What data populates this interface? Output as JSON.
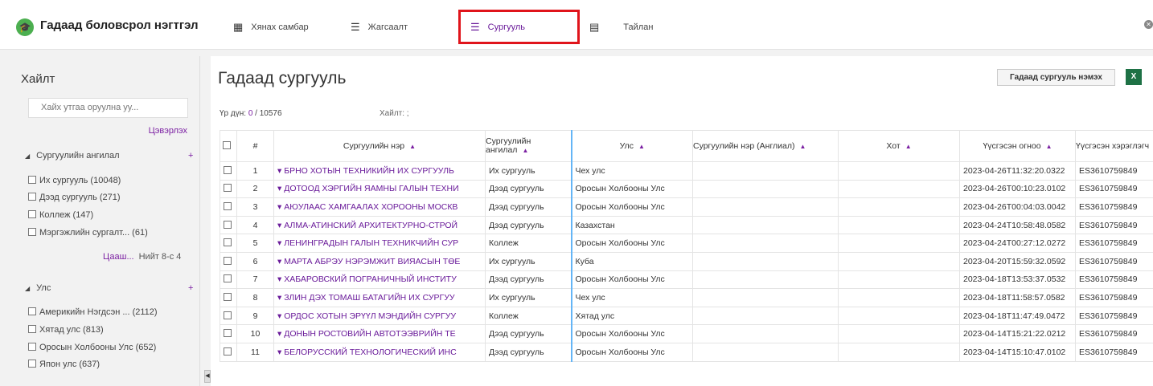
{
  "app": {
    "title": "Гадаад боловсрол нэгтгэл",
    "logo_icon": "graduation-cap-icon"
  },
  "nav": [
    {
      "label": "Хянах самбар",
      "icon": "dashboard-icon"
    },
    {
      "label": "Жагсаалт",
      "icon": "list-icon"
    },
    {
      "label": "Сургууль",
      "icon": "list-bullets-icon",
      "active": true
    },
    {
      "label": "Тайлан",
      "icon": "report-icon"
    }
  ],
  "sidebar": {
    "title": "Хайлт",
    "search_placeholder": "Хайх утгаа оруулна уу...",
    "clear_label": "Цэвэрлэх",
    "facets": [
      {
        "title": "Сургуулийн ангилал",
        "options": [
          "Их сургууль (10048)",
          "Дээд сургууль (271)",
          "Коллеж (147)",
          "Мэргэжлийн сургалт... (61)"
        ],
        "more_label": "Цааш...",
        "total_label": "Нийт 8-с 4"
      },
      {
        "title": "Улс",
        "options": [
          "Америкийн Нэгдсэн ... (2112)",
          "Хятад улс (813)",
          "Оросын Холбооны Улс (652)",
          "Япон улс (637)"
        ]
      }
    ]
  },
  "main": {
    "title": "Гадаад сургууль",
    "add_button": "Гадаад сургууль нэмэх",
    "excel_icon": "excel-icon",
    "result_label": "Үр дүн:",
    "result_shown": "0",
    "result_total": "/ 10576",
    "search_label": "Хайлт: ;",
    "columns": [
      "#",
      "Сургуулийн нэр",
      "Сургуулийн ангилал",
      "Улс",
      "Сургуулийн нэр (Англиал)",
      "Хот",
      "Үүсгэсэн огноо",
      "Үүсгэсэн хэрэглэгч"
    ],
    "rows": [
      {
        "n": "1",
        "name": "БРНО ХОТЫН ТЕХНИКИЙН ИХ СУРГУУЛЬ",
        "type": "Их сургууль",
        "country": "Чех улс",
        "en": "",
        "city": "",
        "created": "2023-04-26T11:32:20.0322",
        "user": "ES3610759849"
      },
      {
        "n": "2",
        "name": "ДОТООД ХЭРГИЙН ЯАМНЫ ГАЛЫН ТЕХНИ",
        "type": "Дээд сургууль",
        "country": "Оросын Холбооны Улс",
        "en": "",
        "city": "",
        "created": "2023-04-26T00:10:23.0102",
        "user": "ES3610759849"
      },
      {
        "n": "3",
        "name": "АЮУЛААС ХАМГААЛАХ ХОРООНЫ МОСКВ",
        "type": "Дээд сургууль",
        "country": "Оросын Холбооны Улс",
        "en": "",
        "city": "",
        "created": "2023-04-26T00:04:03.0042",
        "user": "ES3610759849"
      },
      {
        "n": "4",
        "name": "АЛМА-АТИНСКИЙ АРХИТЕКТУРНО-СТРОЙ",
        "type": "Дээд сургууль",
        "country": "Казахстан",
        "en": "",
        "city": "",
        "created": "2023-04-24T10:58:48.0582",
        "user": "ES3610759849"
      },
      {
        "n": "5",
        "name": "ЛЕНИНГРАДЫН ГАЛЫН ТЕХНИКЧИЙН СУР",
        "type": "Коллеж",
        "country": "Оросын Холбооны Улс",
        "en": "",
        "city": "",
        "created": "2023-04-24T00:27:12.0272",
        "user": "ES3610759849"
      },
      {
        "n": "6",
        "name": "МАРТА АБРЭУ НЭРЭМЖИТ ВИЯАСЫН ТӨЕ",
        "type": "Их сургууль",
        "country": "Куба",
        "en": "",
        "city": "",
        "created": "2023-04-20T15:59:32.0592",
        "user": "ES3610759849"
      },
      {
        "n": "7",
        "name": "ХАБАРОВСКИЙ ПОГРАНИЧНЫЙ ИНСТИТУ",
        "type": "Дээд сургууль",
        "country": "Оросын Холбооны Улс",
        "en": "",
        "city": "",
        "created": "2023-04-18T13:53:37.0532",
        "user": "ES3610759849"
      },
      {
        "n": "8",
        "name": "ЗЛИН ДЭХ ТОМАШ БАТАГИЙН ИХ СУРГУУ",
        "type": "Их сургууль",
        "country": "Чех улс",
        "en": "",
        "city": "",
        "created": "2023-04-18T11:58:57.0582",
        "user": "ES3610759849"
      },
      {
        "n": "9",
        "name": "ОРДОС ХОТЫН ЭРҮҮЛ МЭНДИЙН СУРГУУ",
        "type": "Коллеж",
        "country": "Хятад улс",
        "en": "",
        "city": "",
        "created": "2023-04-18T11:47:49.0472",
        "user": "ES3610759849"
      },
      {
        "n": "10",
        "name": "ДОНЫН РОСТОВИЙН АВТОТЭЭВРИЙН ТЕ",
        "type": "Дээд сургууль",
        "country": "Оросын Холбооны Улс",
        "en": "",
        "city": "",
        "created": "2023-04-14T15:21:22.0212",
        "user": "ES3610759849"
      },
      {
        "n": "11",
        "name": "БЕЛОРУССКИЙ ТЕХНОЛОГИЧЕСКИЙ ИНС",
        "type": "Дээд сургууль",
        "country": "Оросын Холбооны Улс",
        "en": "",
        "city": "",
        "created": "2023-04-14T15:10:47.0102",
        "user": "ES3610759849"
      }
    ]
  },
  "colors": {
    "accent": "#7b1fa2",
    "highlight_border": "#e0141b",
    "excel": "#1e7145"
  }
}
